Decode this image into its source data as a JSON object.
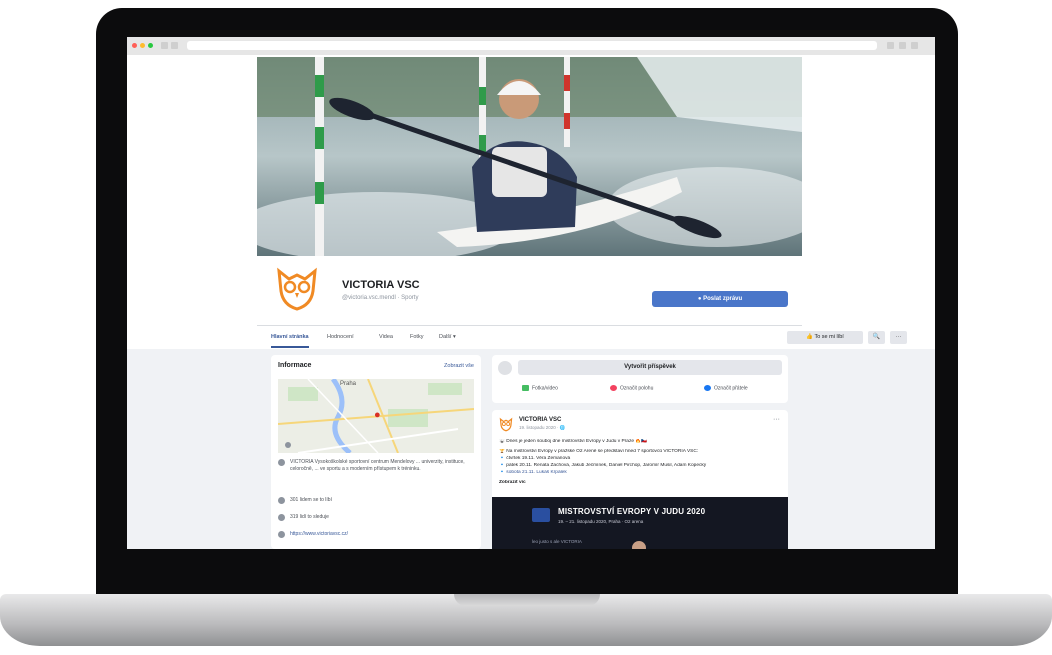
{
  "page": {
    "name": "VICTORIA VSC",
    "handle": "@victoria.vsc.mendl · Sporty",
    "send_message": "Poslat zprávu",
    "tabs": [
      "Hlavní stránka",
      "Hodnocení",
      "Videa",
      "Fotky",
      "Další ▾"
    ],
    "like_button": "To se mi líbí",
    "search_symbol": "🔍",
    "more_symbol": "···"
  },
  "info": {
    "title": "Informace",
    "see_all": "Zobrazit vše",
    "map_city": "Praha",
    "about": "VICTORIA Vysokoškolské sportovní centrum Mendelovy ... univerzity, instituce, celoročně, ... ve sportu a s moderním přístupem k tréninku.",
    "likes": "301 lidem se to líbí",
    "followers": "319 lidí to sleduje",
    "website": "https://www.victoriavsc.cz/"
  },
  "composer": {
    "create_post": "Vytvořit příspěvek",
    "actions": [
      "Fotka/video",
      "Označit polohu",
      "Označit přátele"
    ]
  },
  "post": {
    "author": "VICTORIA VSC",
    "date": "19. listopadu 2020 · 🌐",
    "more": "···",
    "line1": "🥋 Dnes je jeden souboj dne mistrovství Evropy v Judu v Praze 🔥🇨🇿",
    "line2": "🏆 Na mistrovství Evropy v pražské O2 Areně se představí hned 7 sportovců VICTORIA VSC:",
    "line3": "🔹 čtvrtek 19.11. Věra Zemanová",
    "line4": "🔹 pátek 20.11. Renata Zachová, Jakub Ječmínek, Daniel Pirchop, Jaromír Musil, Adam Kopecký",
    "line5": "🔹 sobota 21.11. Lukáš Krpálek",
    "see_more": "Zobrazit víc",
    "banner_title": "MISTROVSTVÍ EVROPY V JUDU 2020",
    "banner_sub": "19. – 21. listopadu 2020, Praha · O2 arena",
    "banner_foot": "leo justo s ale VICTORIA"
  },
  "colors": {
    "accent": "#4a76c9",
    "link": "#385898",
    "logo_orange": "#f08a24"
  }
}
